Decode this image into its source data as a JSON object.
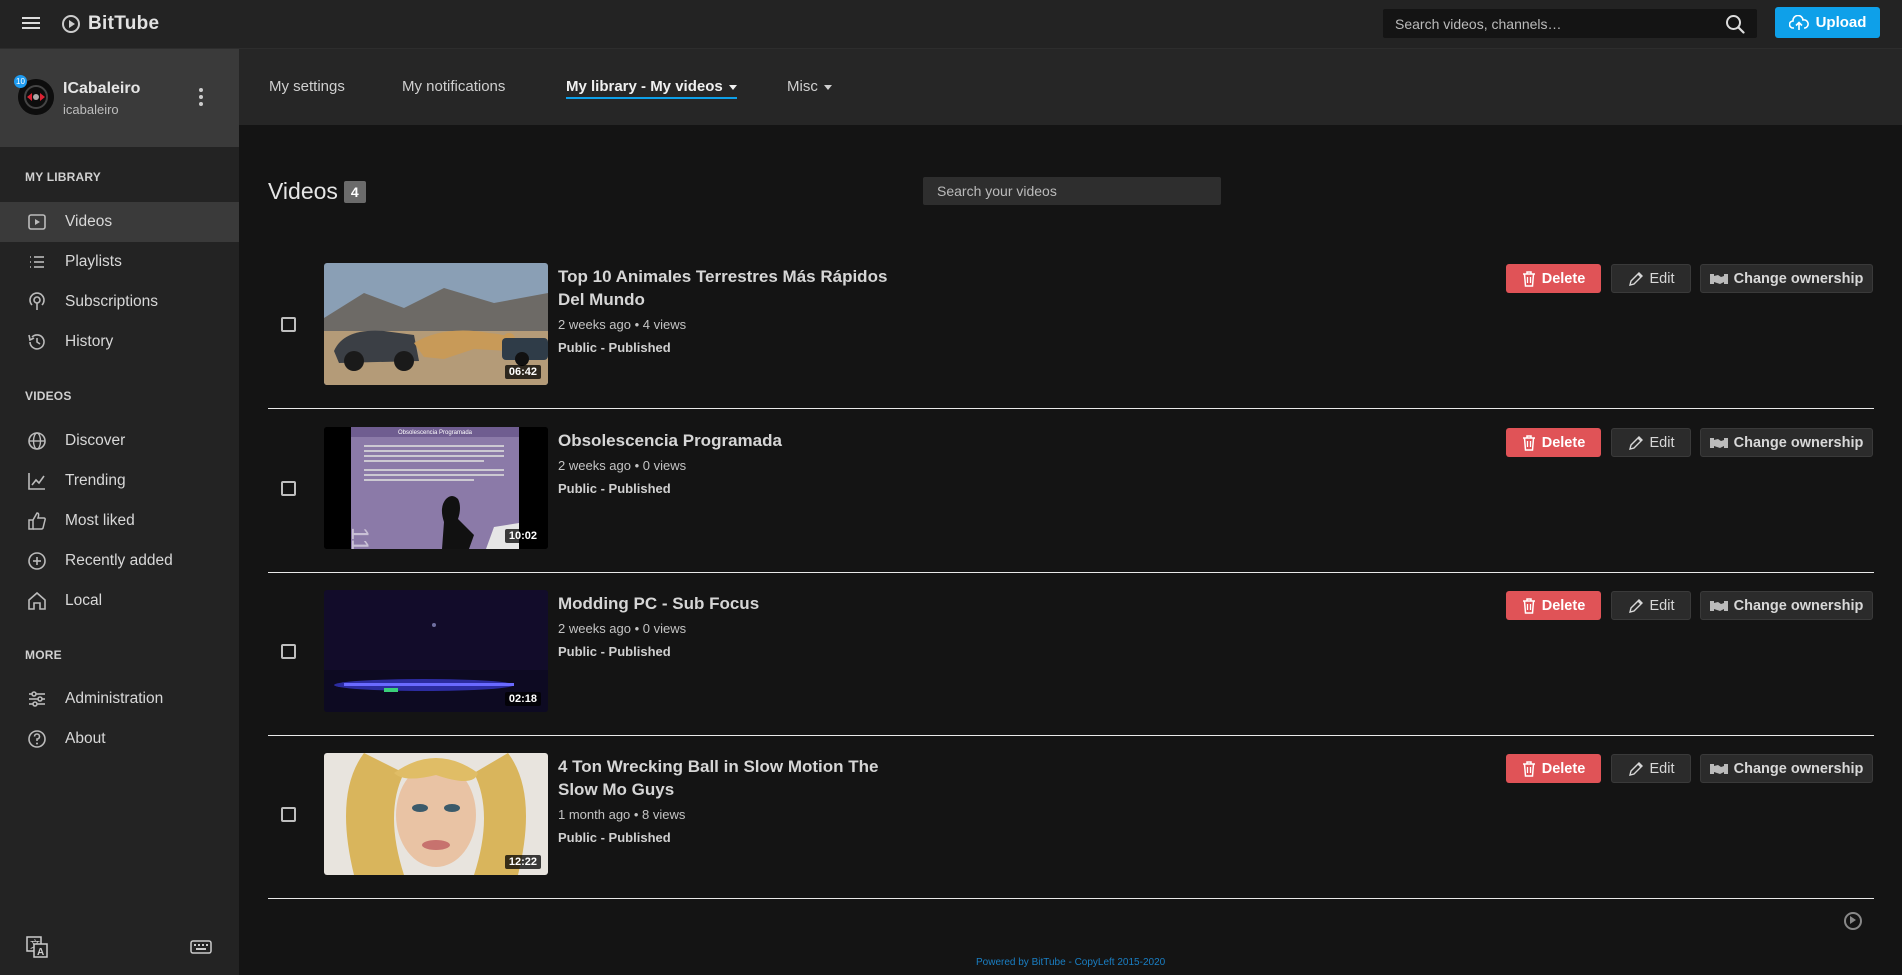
{
  "header": {
    "logo_text": "BitTube",
    "search_placeholder": "Search videos, channels…",
    "upload_label": "Upload",
    "accent_color": "#0ea0e9"
  },
  "user": {
    "display_name": "ICabaleiro",
    "handle": "icabaleiro",
    "badge": "10"
  },
  "sidebar": {
    "sections": [
      {
        "label": "MY LIBRARY"
      },
      {
        "label": "VIDEOS"
      },
      {
        "label": "MORE"
      }
    ],
    "library_items": [
      {
        "label": "Videos",
        "icon": "video-icon",
        "active": true
      },
      {
        "label": "Playlists",
        "icon": "list-icon"
      },
      {
        "label": "Subscriptions",
        "icon": "subscriptions-icon"
      },
      {
        "label": "History",
        "icon": "history-icon"
      }
    ],
    "video_items": [
      {
        "label": "Discover",
        "icon": "globe-icon"
      },
      {
        "label": "Trending",
        "icon": "trending-icon"
      },
      {
        "label": "Most liked",
        "icon": "thumbs-up-icon"
      },
      {
        "label": "Recently added",
        "icon": "plus-circle-icon"
      },
      {
        "label": "Local",
        "icon": "home-icon"
      }
    ],
    "more_items": [
      {
        "label": "Administration",
        "icon": "sliders-icon"
      },
      {
        "label": "About",
        "icon": "help-icon"
      }
    ]
  },
  "subnav": {
    "items": [
      {
        "label": "My settings"
      },
      {
        "label": "My notifications"
      },
      {
        "label": "My library - My videos",
        "active": true
      },
      {
        "label": "Misc"
      }
    ]
  },
  "main": {
    "heading": "Videos",
    "count": "4",
    "search_placeholder": "Search your videos",
    "actions": {
      "delete": "Delete",
      "edit": "Edit",
      "change_ownership": "Change ownership"
    },
    "videos": [
      {
        "title": "Top 10 Animales Terrestres Más Rápidos Del Mundo",
        "meta": "2 weeks ago • 4 views",
        "status": "Public - Published",
        "duration": "06:42"
      },
      {
        "title": "Obsolescencia Programada",
        "meta": "2 weeks ago • 0 views",
        "status": "Public - Published",
        "duration": "10:02",
        "thumb_heading": "Obsolescencia Programada"
      },
      {
        "title": "Modding PC - Sub Focus",
        "meta": "2 weeks ago • 0 views",
        "status": "Public - Published",
        "duration": "02:18"
      },
      {
        "title": "4 Ton Wrecking Ball in Slow Motion The Slow Mo Guys",
        "meta": "1 month ago • 8 views",
        "status": "Public - Published",
        "duration": "12:22"
      }
    ]
  },
  "footer": {
    "text": "Powered by BitTube - CopyLeft 2015-2020"
  }
}
